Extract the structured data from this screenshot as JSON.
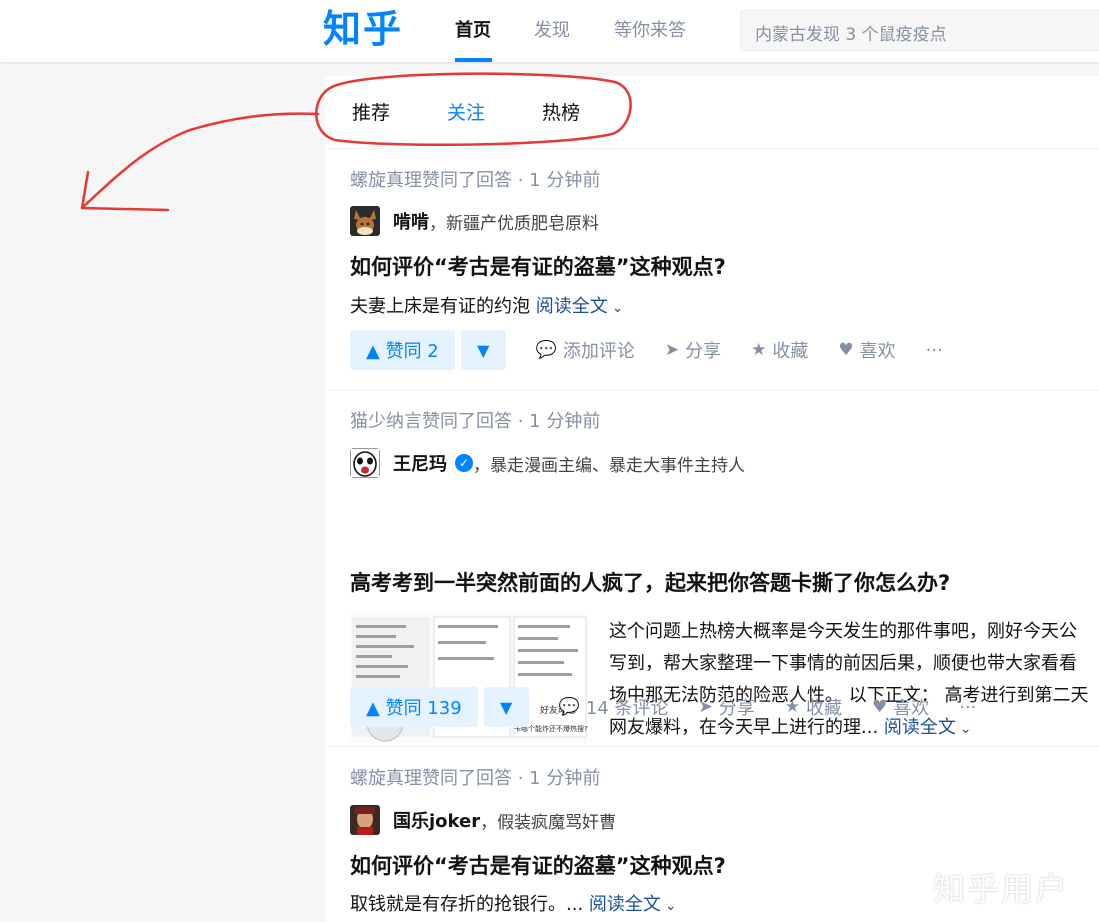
{
  "header": {
    "logo": "知乎",
    "tabs": [
      "首页",
      "发现",
      "等你来答"
    ],
    "search_placeholder": "内蒙古发现 3 个鼠疫疫点"
  },
  "feed_tabs": [
    "推荐",
    "关注",
    "热榜"
  ],
  "items": [
    {
      "meta": "螺旋真理赞同了回答 · 1 分钟前",
      "author": "啃啃",
      "bio": "，新疆产优质肥皂原料",
      "title": "如何评价“考古是有证的盗墓”这种观点?",
      "excerpt": "夫妻上床是有证的约泡",
      "read_more": "阅读全文",
      "vote": "▲ 赞同 2",
      "comment": "添加评论",
      "share": "分享",
      "collect": "收藏",
      "like": "喜欢"
    },
    {
      "meta": "猫少纳言赞同了回答 · 1 分钟前",
      "author": "王尼玛",
      "bio": "，暴走漫画主编、暴走大事件主持人",
      "title": "高考考到一半突然前面的人疯了，起来把你答题卡撕了你怎么办?",
      "excerpt_lines": [
        "这个问题上热榜大概率是今天发生的那件事吧，刚好今天公",
        "写到，帮大家整理一下事情的前因后果，顺便也带大家看看",
        "场中那无法防范的险恶人性。 以下正文： 高考进行到第二天",
        "网友爆料，在今天早上进行的理..."
      ],
      "read_more": "阅读全文",
      "thumb_text": [
        "好友动态",
        "卡哪个能炸还不爆热搜? ?"
      ],
      "vote": "▲ 赞同 139",
      "comment": "14 条评论",
      "share": "分享",
      "collect": "收藏",
      "like": "喜欢"
    },
    {
      "meta": "螺旋真理赞同了回答 · 1 分钟前",
      "author": "国乐joker",
      "bio": "，假装疯魔骂奸曹",
      "title": "如何评价“考古是有证的盗墓”这种观点?",
      "excerpt": "取钱就是有存折的抢银行。...",
      "read_more": "阅读全文"
    }
  ],
  "watermark": "知乎用户",
  "colors": {
    "brand": "#0084ff",
    "annotation": "#e53935"
  }
}
